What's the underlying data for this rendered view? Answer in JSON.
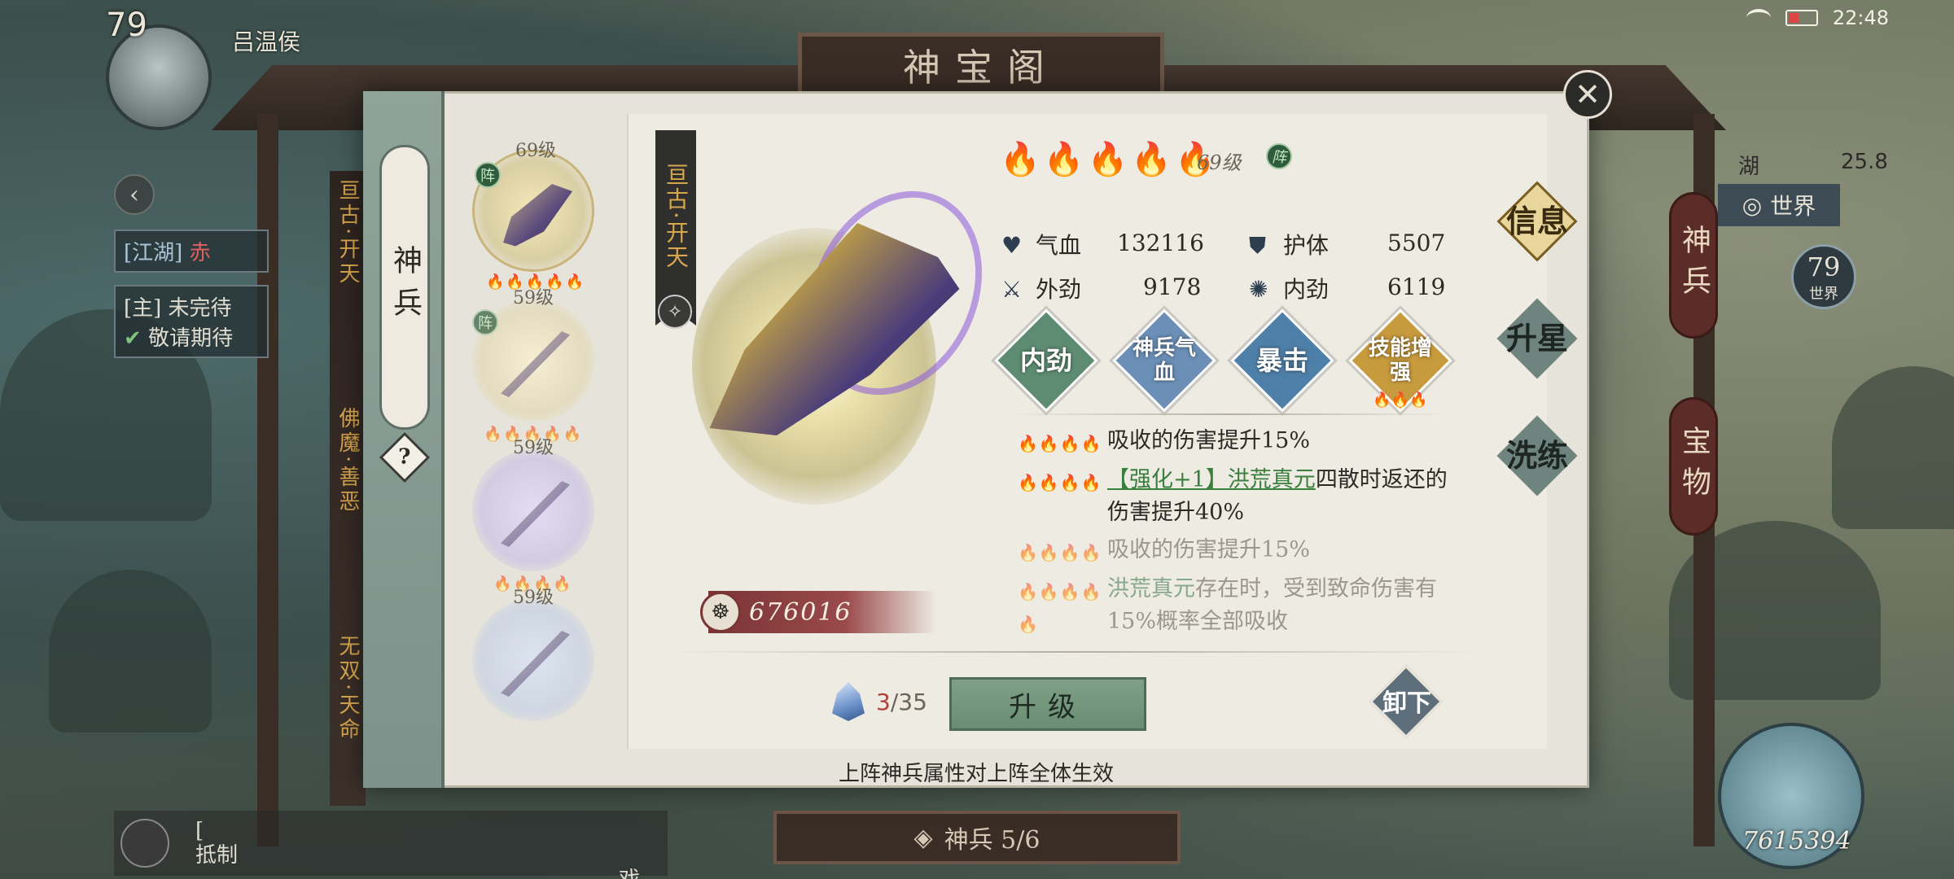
{
  "status": {
    "time": "22:48"
  },
  "player": {
    "level": "79",
    "name": "吕温侯"
  },
  "building": {
    "title": "神宝阁"
  },
  "left_map": {
    "back_label": "",
    "quest_tag": "[江湖]",
    "quest_text": "赤",
    "main_quest": "[主] 未完待",
    "main_quest_sub": "敬请期待",
    "chat_line1": "[",
    "chat_line2": "抵制",
    "chat_line3": "戏。"
  },
  "right_map": {
    "location": "湖",
    "coords": "25.8",
    "world_button": "世界",
    "world_level": "79",
    "world_level_label": "世界",
    "vertical_tabs": [
      "神兵",
      "宝物"
    ],
    "score": "7615394"
  },
  "panel": {
    "side_tab": "神兵",
    "help": "?",
    "close_icon": "close-icon",
    "list": [
      {
        "level": "69级",
        "badge": "阵",
        "stars_on": 3,
        "stars_off": 2,
        "category": "亘古·开天",
        "selected": true
      },
      {
        "level": "59级",
        "badge": "阵",
        "stars_on": 2,
        "stars_off": 3,
        "category": "佛魔·善恶"
      },
      {
        "level": "59级",
        "badge": "",
        "stars_on": 4,
        "stars_off": 0,
        "category": "无双·天命"
      },
      {
        "level": "59级",
        "badge": "",
        "stars_on": 0,
        "stars_off": 0,
        "category": ""
      }
    ],
    "list_categories": [
      "亘古·开天",
      "佛魔·善恶",
      "无双·天命"
    ],
    "weapon_name": "亘古·开天",
    "power": "676016",
    "flames_on": 3,
    "flames_off": 2,
    "weapon_level": "69级",
    "weapon_badge": "阵",
    "stats": [
      {
        "label": "气血",
        "value": "132116",
        "icon": "heart-icon"
      },
      {
        "label": "护体",
        "value": "5507",
        "icon": "shield-icon"
      },
      {
        "label": "外劲",
        "value": "9178",
        "icon": "sword-icon"
      },
      {
        "label": "内劲",
        "value": "6119",
        "icon": "swirl-icon"
      }
    ],
    "skills": [
      {
        "label": "内劲",
        "color": "#5e8c73"
      },
      {
        "label": "神兵气血",
        "color": "#6b8fb6"
      },
      {
        "label": "暴击",
        "color": "#4e7fa8"
      },
      {
        "label": "技能增强",
        "color": "#c79a3d",
        "sub": "333"
      }
    ],
    "effects": [
      {
        "stars": "4444",
        "stars_on": 1,
        "text": "吸收的伤害提升15%"
      },
      {
        "stars": "4444",
        "stars_on": 3,
        "prefix": "【强化+1】洪荒真元",
        "text": "四散时返还的伤害提升40%"
      },
      {
        "stars": "4444",
        "stars_on": 4,
        "text": "吸收的伤害提升15%",
        "dim": true
      },
      {
        "stars": "44444",
        "stars_on": 5,
        "prefix": "洪荒真元",
        "text": "存在时，受到致命伤害有15%概率全部吸收",
        "dim": true
      }
    ],
    "upgrade_cost": "3",
    "upgrade_total": "/35",
    "upgrade_button": "升级",
    "unload_button": "卸下",
    "footnote": "上阵神兵属性对上阵全体生效",
    "right_tabs": [
      "信息",
      "升星",
      "洗练"
    ]
  },
  "bottom": {
    "label": "神兵 5/6"
  }
}
